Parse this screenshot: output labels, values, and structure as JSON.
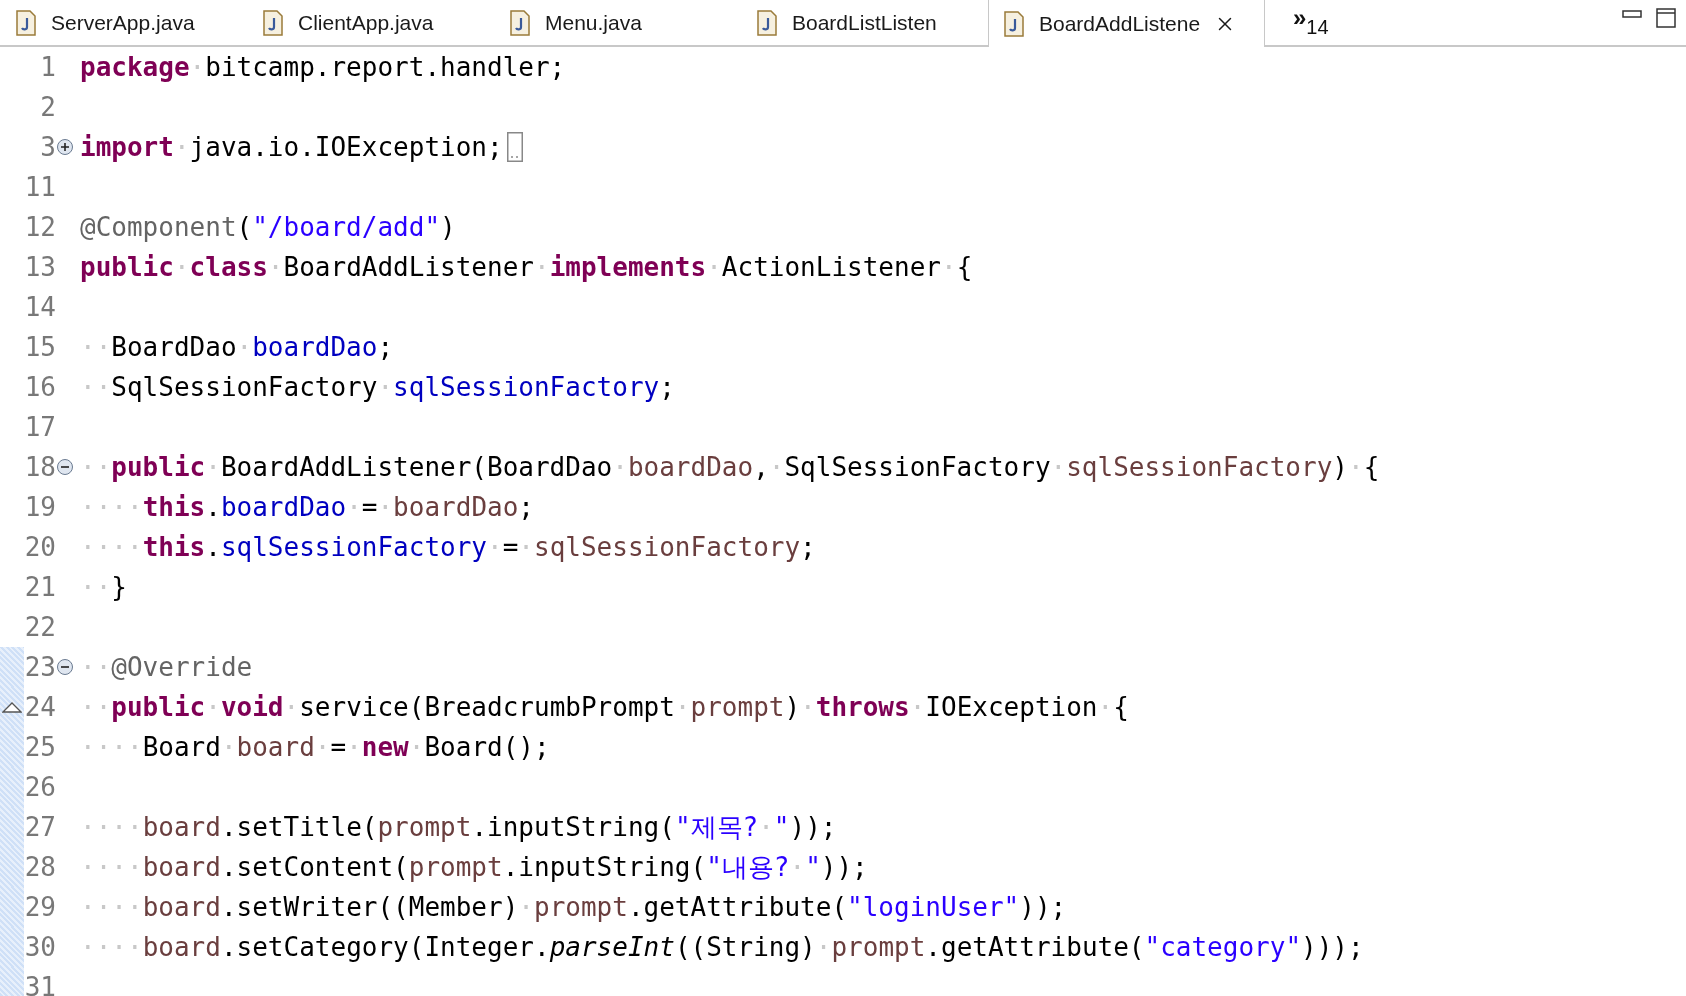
{
  "tabs": [
    {
      "label": "ServerApp.java",
      "selected": false
    },
    {
      "label": "ClientApp.java",
      "selected": false
    },
    {
      "label": "Menu.java",
      "selected": false
    },
    {
      "label": "BoardListListen",
      "selected": false
    },
    {
      "label": "BoardAddListene",
      "selected": true
    }
  ],
  "overflow": {
    "symbol": "»",
    "count": "14"
  },
  "lines": [
    {
      "number": "1",
      "kind": "plain",
      "ranged": false,
      "tokens": [
        {
          "kind": "kw",
          "text": "package"
        },
        {
          "kind": "ws",
          "text": "·"
        },
        {
          "kind": "plain",
          "text": "bitcamp.report.handler;"
        }
      ]
    },
    {
      "number": "2",
      "kind": "plain",
      "ranged": false
    },
    {
      "number": "3",
      "kind": "expandable",
      "ranged": false,
      "folded": true,
      "tokens": [
        {
          "kind": "kw",
          "text": "import"
        },
        {
          "kind": "ws",
          "text": "·"
        },
        {
          "kind": "plain",
          "text": "java.io.IOException;"
        }
      ]
    },
    {
      "number": "11",
      "kind": "plain",
      "ranged": false
    },
    {
      "number": "12",
      "kind": "plain",
      "ranged": false,
      "tokens": [
        {
          "kind": "ann",
          "text": "@Component"
        },
        {
          "kind": "plain",
          "text": "("
        },
        {
          "kind": "str",
          "text": "\"/board/add\""
        },
        {
          "kind": "plain",
          "text": ")"
        }
      ]
    },
    {
      "number": "13",
      "kind": "plain",
      "ranged": false,
      "tokens": [
        {
          "kind": "kw",
          "text": "public"
        },
        {
          "kind": "ws",
          "text": "·"
        },
        {
          "kind": "kw",
          "text": "class"
        },
        {
          "kind": "ws",
          "text": "·"
        },
        {
          "kind": "plain",
          "text": "BoardAddListener"
        },
        {
          "kind": "ws",
          "text": "·"
        },
        {
          "kind": "kw",
          "text": "implements"
        },
        {
          "kind": "ws",
          "text": "·"
        },
        {
          "kind": "plain",
          "text": "ActionListener"
        },
        {
          "kind": "ws",
          "text": "·"
        },
        {
          "kind": "plain",
          "text": "{"
        }
      ]
    },
    {
      "number": "14",
      "kind": "plain",
      "ranged": false
    },
    {
      "number": "15",
      "kind": "plain",
      "ranged": false,
      "tokens": [
        {
          "kind": "ws",
          "text": "··"
        },
        {
          "kind": "plain",
          "text": "BoardDao"
        },
        {
          "kind": "ws",
          "text": "·"
        },
        {
          "kind": "field",
          "text": "boardDao"
        },
        {
          "kind": "plain",
          "text": ";"
        }
      ]
    },
    {
      "number": "16",
      "kind": "plain",
      "ranged": false,
      "tokens": [
        {
          "kind": "ws",
          "text": "··"
        },
        {
          "kind": "plain",
          "text": "SqlSessionFactory"
        },
        {
          "kind": "ws",
          "text": "·"
        },
        {
          "kind": "field",
          "text": "sqlSessionFactory"
        },
        {
          "kind": "plain",
          "text": ";"
        }
      ]
    },
    {
      "number": "17",
      "kind": "plain",
      "ranged": false
    },
    {
      "number": "18",
      "kind": "collapsible",
      "ranged": false,
      "tokens": [
        {
          "kind": "ws",
          "text": "··"
        },
        {
          "kind": "kw",
          "text": "public"
        },
        {
          "kind": "ws",
          "text": "·"
        },
        {
          "kind": "plain",
          "text": "BoardAddListener(BoardDao"
        },
        {
          "kind": "ws",
          "text": "·"
        },
        {
          "kind": "local",
          "text": "boardDao"
        },
        {
          "kind": "plain",
          "text": ","
        },
        {
          "kind": "ws",
          "text": "·"
        },
        {
          "kind": "plain",
          "text": "SqlSessionFactory"
        },
        {
          "kind": "ws",
          "text": "·"
        },
        {
          "kind": "local",
          "text": "sqlSessionFactory"
        },
        {
          "kind": "plain",
          "text": ")"
        },
        {
          "kind": "ws",
          "text": "·"
        },
        {
          "kind": "plain",
          "text": "{"
        }
      ]
    },
    {
      "number": "19",
      "kind": "plain",
      "ranged": false,
      "tokens": [
        {
          "kind": "ws",
          "text": "····"
        },
        {
          "kind": "kw",
          "text": "this"
        },
        {
          "kind": "plain",
          "text": "."
        },
        {
          "kind": "field",
          "text": "boardDao"
        },
        {
          "kind": "ws",
          "text": "·"
        },
        {
          "kind": "plain",
          "text": "="
        },
        {
          "kind": "ws",
          "text": "·"
        },
        {
          "kind": "local",
          "text": "boardDao"
        },
        {
          "kind": "plain",
          "text": ";"
        }
      ]
    },
    {
      "number": "20",
      "kind": "plain",
      "ranged": false,
      "tokens": [
        {
          "kind": "ws",
          "text": "····"
        },
        {
          "kind": "kw",
          "text": "this"
        },
        {
          "kind": "plain",
          "text": "."
        },
        {
          "kind": "field",
          "text": "sqlSessionFactory"
        },
        {
          "kind": "ws",
          "text": "·"
        },
        {
          "kind": "plain",
          "text": "="
        },
        {
          "kind": "ws",
          "text": "·"
        },
        {
          "kind": "local",
          "text": "sqlSessionFactory"
        },
        {
          "kind": "plain",
          "text": ";"
        }
      ]
    },
    {
      "number": "21",
      "kind": "plain",
      "ranged": false,
      "tokens": [
        {
          "kind": "ws",
          "text": "··"
        },
        {
          "kind": "plain",
          "text": "}"
        }
      ]
    },
    {
      "number": "22",
      "kind": "plain",
      "ranged": false
    },
    {
      "number": "23",
      "kind": "collapsible",
      "ranged": true,
      "tokens": [
        {
          "kind": "ws",
          "text": "··"
        },
        {
          "kind": "ann",
          "text": "@Override"
        }
      ]
    },
    {
      "number": "24",
      "kind": "override",
      "ranged": true,
      "tokens": [
        {
          "kind": "ws",
          "text": "··"
        },
        {
          "kind": "kw",
          "text": "public"
        },
        {
          "kind": "ws",
          "text": "·"
        },
        {
          "kind": "kw",
          "text": "void"
        },
        {
          "kind": "ws",
          "text": "·"
        },
        {
          "kind": "plain",
          "text": "service(BreadcrumbPrompt"
        },
        {
          "kind": "ws",
          "text": "·"
        },
        {
          "kind": "local",
          "text": "prompt"
        },
        {
          "kind": "plain",
          "text": ")"
        },
        {
          "kind": "ws",
          "text": "·"
        },
        {
          "kind": "kw",
          "text": "throws"
        },
        {
          "kind": "ws",
          "text": "·"
        },
        {
          "kind": "plain",
          "text": "IOException"
        },
        {
          "kind": "ws",
          "text": "·"
        },
        {
          "kind": "plain",
          "text": "{"
        }
      ]
    },
    {
      "number": "25",
      "kind": "plain",
      "ranged": true,
      "tokens": [
        {
          "kind": "ws",
          "text": "····"
        },
        {
          "kind": "plain",
          "text": "Board"
        },
        {
          "kind": "ws",
          "text": "·"
        },
        {
          "kind": "local",
          "text": "board"
        },
        {
          "kind": "ws",
          "text": "·"
        },
        {
          "kind": "plain",
          "text": "="
        },
        {
          "kind": "ws",
          "text": "·"
        },
        {
          "kind": "kw",
          "text": "new"
        },
        {
          "kind": "ws",
          "text": "·"
        },
        {
          "kind": "plain",
          "text": "Board();"
        }
      ]
    },
    {
      "number": "26",
      "kind": "plain",
      "ranged": true
    },
    {
      "number": "27",
      "kind": "plain",
      "ranged": true,
      "tokens": [
        {
          "kind": "ws",
          "text": "····"
        },
        {
          "kind": "local",
          "text": "board"
        },
        {
          "kind": "plain",
          "text": ".setTitle("
        },
        {
          "kind": "local",
          "text": "prompt"
        },
        {
          "kind": "plain",
          "text": ".inputString("
        },
        {
          "kind": "str",
          "text": "\"제목?"
        },
        {
          "kind": "ws",
          "text": "·"
        },
        {
          "kind": "str",
          "text": "\""
        },
        {
          "kind": "plain",
          "text": "));"
        }
      ]
    },
    {
      "number": "28",
      "kind": "plain",
      "ranged": true,
      "tokens": [
        {
          "kind": "ws",
          "text": "····"
        },
        {
          "kind": "local",
          "text": "board"
        },
        {
          "kind": "plain",
          "text": ".setContent("
        },
        {
          "kind": "local",
          "text": "prompt"
        },
        {
          "kind": "plain",
          "text": ".inputString("
        },
        {
          "kind": "str",
          "text": "\"내용?"
        },
        {
          "kind": "ws",
          "text": "·"
        },
        {
          "kind": "str",
          "text": "\""
        },
        {
          "kind": "plain",
          "text": "));"
        }
      ]
    },
    {
      "number": "29",
      "kind": "plain",
      "ranged": true,
      "tokens": [
        {
          "kind": "ws",
          "text": "····"
        },
        {
          "kind": "local",
          "text": "board"
        },
        {
          "kind": "plain",
          "text": ".setWriter((Member)"
        },
        {
          "kind": "ws",
          "text": "·"
        },
        {
          "kind": "local",
          "text": "prompt"
        },
        {
          "kind": "plain",
          "text": ".getAttribute("
        },
        {
          "kind": "str",
          "text": "\"loginUser\""
        },
        {
          "kind": "plain",
          "text": "));"
        }
      ]
    },
    {
      "number": "30",
      "kind": "plain",
      "ranged": true,
      "tokens": [
        {
          "kind": "ws",
          "text": "····"
        },
        {
          "kind": "local",
          "text": "board"
        },
        {
          "kind": "plain",
          "text": ".setCategory(Integer."
        },
        {
          "kind": "italic",
          "text": "parseInt"
        },
        {
          "kind": "plain",
          "text": "((String)"
        },
        {
          "kind": "ws",
          "text": "·"
        },
        {
          "kind": "local",
          "text": "prompt"
        },
        {
          "kind": "plain",
          "text": ".getAttribute("
        },
        {
          "kind": "str",
          "text": "\"category\""
        },
        {
          "kind": "plain",
          "text": ")));"
        }
      ]
    },
    {
      "number": "31",
      "kind": "plain",
      "ranged": true
    }
  ]
}
